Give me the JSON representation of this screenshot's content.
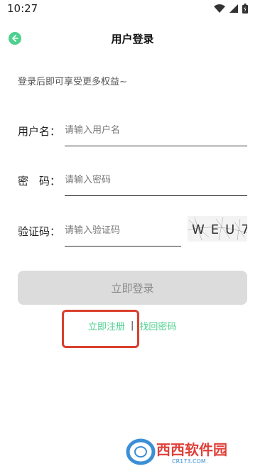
{
  "status_bar": {
    "time": "10:27"
  },
  "header": {
    "title": "用户登录"
  },
  "hint": "登录后即可享受更多权益~",
  "form": {
    "username_label": "用户名：",
    "username_placeholder": "请输入用户名",
    "password_label": "密　码：",
    "password_placeholder": "请输入密码",
    "captcha_label": "验证码：",
    "captcha_placeholder": "请输入验证码",
    "captcha_text": "WEU7"
  },
  "actions": {
    "login_label": "立即登录",
    "register_label": "立即注册",
    "separator": "|",
    "forgot_label": "找回密码"
  },
  "watermark": {
    "brand": "西西软件园",
    "domain": "CR173.COM"
  },
  "colors": {
    "accent": "#4fd08f",
    "button_bg": "#dcdcdc",
    "highlight": "#d9402f"
  }
}
